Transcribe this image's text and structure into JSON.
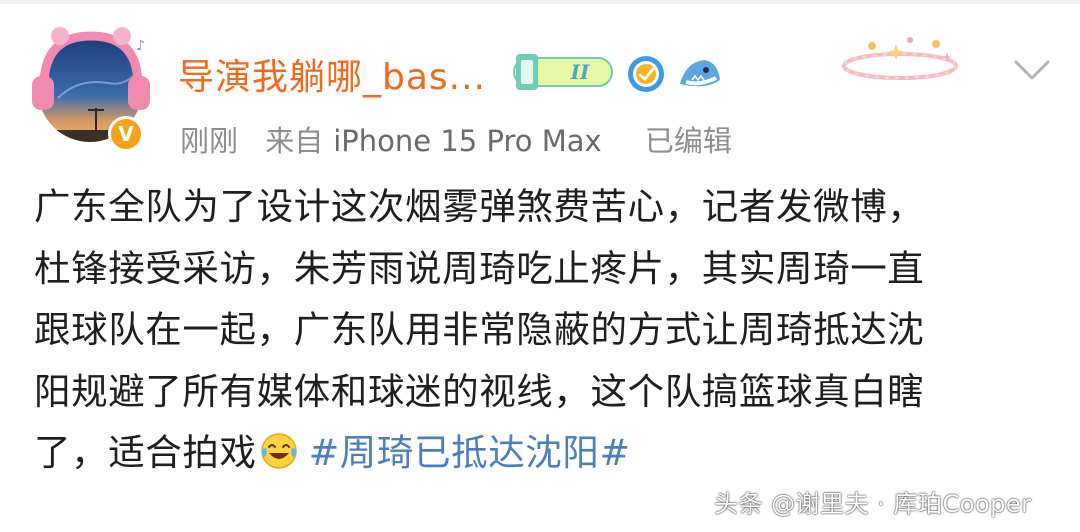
{
  "post": {
    "username": "导演我躺哪_bas...",
    "level_badge": "II",
    "meta": {
      "time": "刚刚",
      "source_prefix": "来自",
      "device": "iPhone 15 Pro Max",
      "edited": "已编辑"
    },
    "lines": [
      "广东全队为了设计这次烟雾弹煞费苦心，记者发微博，",
      "杜锋接受采访，朱芳雨说周琦吃止疼片，其实周琦一直",
      "跟球队在一起，广东队用非常隐蔽的方式让周琦抵达沈",
      "阳规避了所有媒体和球迷的视线，这个队搞篮球真白瞎",
      "了，适合拍戏"
    ],
    "hashtag": "#周琦已抵达沈阳#",
    "emoji": "laughing-tears-emoji"
  },
  "icons": {
    "avatar": "avatar-headphones",
    "verified": "v-verified-icon",
    "level": "level-badge-icon",
    "official": "shield-verify-icon",
    "shark": "shark-icon",
    "more": "chevron-down-icon"
  },
  "colors": {
    "username": "#f26a1b",
    "hashtag": "#4e7fbd",
    "meta": "#8f8f8f",
    "text": "#1f1f1f",
    "verified_badge": "#f7a21b"
  },
  "watermark": "头条 @谢里夫 · 库珀Cooper"
}
